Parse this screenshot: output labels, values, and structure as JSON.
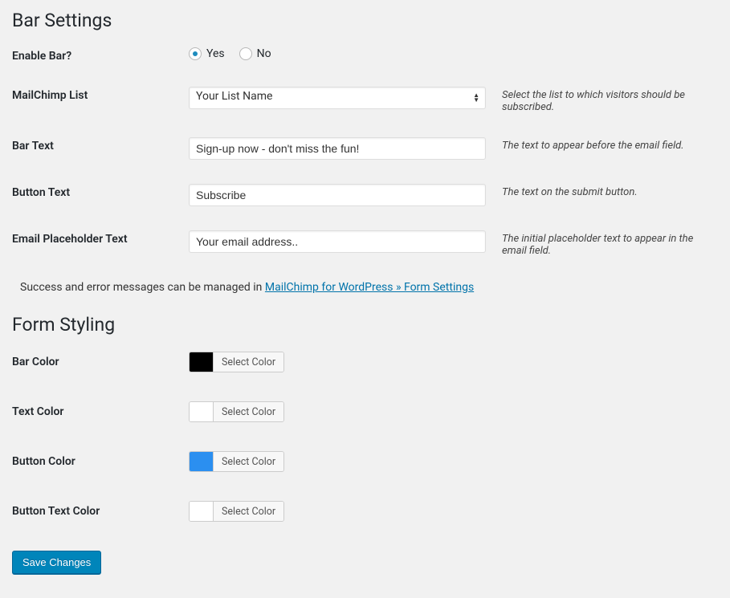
{
  "sections": {
    "bar_settings": "Bar Settings",
    "form_styling": "Form Styling"
  },
  "enable_bar": {
    "label": "Enable Bar?",
    "yes": "Yes",
    "no": "No",
    "value": "yes"
  },
  "mailchimp_list": {
    "label": "MailChimp List",
    "selected": "Your List Name",
    "help": "Select the list to which visitors should be subscribed."
  },
  "bar_text": {
    "label": "Bar Text",
    "value": "Sign-up now - don't miss the fun!",
    "help": "The text to appear before the email field."
  },
  "button_text": {
    "label": "Button Text",
    "value": "Subscribe",
    "help": "The text on the submit button."
  },
  "email_placeholder": {
    "label": "Email Placeholder Text",
    "value": "Your email address..",
    "help": "The initial placeholder text to appear in the email field."
  },
  "info_message": {
    "prefix": "Success and error messages can be managed in ",
    "link": "MailChimp for WordPress » Form Settings"
  },
  "colors": {
    "select_label": "Select Color",
    "bar_color": {
      "label": "Bar Color",
      "value": "#000000"
    },
    "text_color": {
      "label": "Text Color",
      "value": "#ffffff"
    },
    "button_color": {
      "label": "Button Color",
      "value": "#2b8ff0"
    },
    "button_text_color": {
      "label": "Button Text Color",
      "value": "#ffffff"
    }
  },
  "save": "Save Changes"
}
